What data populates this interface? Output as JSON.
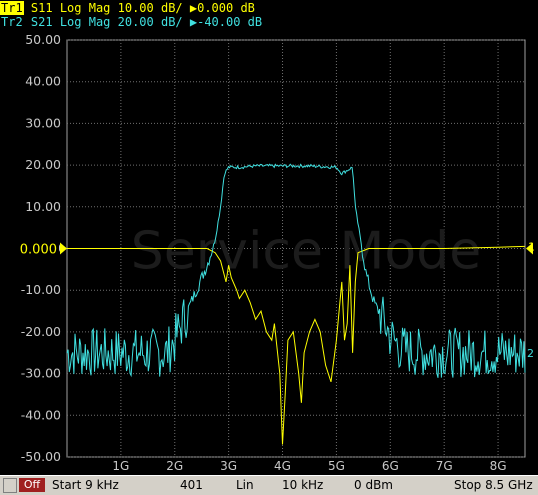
{
  "traces": [
    {
      "id_label": "Tr1",
      "text": "S11 Log Mag 10.00 dB/ ",
      "ref_marker": "▶",
      "ref_value": "0.000 dB",
      "color": "#ffff00"
    },
    {
      "id_label": "Tr2",
      "text": "S21 Log Mag 20.00 dB/ ",
      "ref_marker": "▶",
      "ref_value": "-40.00 dB",
      "color": "#40e0e0"
    }
  ],
  "watermark": "Service Mode",
  "ref_line_label": "0.000",
  "trace_end_labels": {
    "tr1": "1",
    "tr2": "2"
  },
  "chart_data": {
    "type": "line",
    "xlabel": "",
    "ylabel": "",
    "xlim": [
      9e-06,
      8.5
    ],
    "ylim": [
      -50,
      50
    ],
    "y_ticks": [
      "50.00",
      "40.00",
      "30.00",
      "20.00",
      "10.00",
      "0.000",
      "-10.00",
      "-20.00",
      "-30.00",
      "-40.00",
      "-50.00"
    ],
    "x_ticks": [
      "1G",
      "2G",
      "3G",
      "4G",
      "5G",
      "6G",
      "7G",
      "8G"
    ],
    "grid": true,
    "series": [
      {
        "name": "S11",
        "color": "#ffff00",
        "x": [
          0,
          2.6,
          2.75,
          2.85,
          2.95,
          3.0,
          3.05,
          3.15,
          3.2,
          3.3,
          3.4,
          3.5,
          3.6,
          3.7,
          3.8,
          3.85,
          3.95,
          4.0,
          4.05,
          4.1,
          4.2,
          4.3,
          4.35,
          4.4,
          4.5,
          4.6,
          4.7,
          4.8,
          4.9,
          5.0,
          5.1,
          5.15,
          5.2,
          5.25,
          5.3,
          5.35,
          5.4,
          5.5,
          5.6,
          6,
          7,
          8,
          8.5
        ],
        "y": [
          0,
          0,
          -1,
          -3,
          -8,
          -4,
          -7,
          -10,
          -12,
          -10,
          -13,
          -17,
          -15,
          -20,
          -22,
          -18,
          -30,
          -47,
          -35,
          -22,
          -20,
          -30,
          -37,
          -25,
          -20,
          -17,
          -20,
          -28,
          -32,
          -22,
          -8,
          -22,
          -18,
          -4,
          -25,
          -8,
          -1,
          -0.5,
          0,
          0,
          0,
          0.3,
          0.5
        ]
      },
      {
        "name": "S21",
        "color": "#40e0e0",
        "x": [
          0,
          0.5,
          1,
          1.5,
          1.85,
          2.0,
          2.2,
          2.4,
          2.6,
          2.75,
          2.85,
          2.92,
          3.0,
          3.2,
          3.5,
          4,
          4.5,
          5,
          5.1,
          5.3,
          5.35,
          5.45,
          5.55,
          5.7,
          5.9,
          6.0,
          6.2,
          6.5,
          7,
          7.5,
          8,
          8.5
        ],
        "y": [
          -25,
          -25,
          -25,
          -25,
          -25,
          -22,
          -16,
          -10,
          -4,
          2,
          10,
          18,
          19.5,
          19.5,
          19.8,
          19.8,
          19.8,
          19.5,
          18,
          19.5,
          10,
          2,
          -6,
          -13,
          -18,
          -21,
          -24,
          -25,
          -25,
          -25,
          -25,
          -25
        ],
        "noise": true
      }
    ]
  },
  "status_bar": {
    "off_label": "Off",
    "start": "Start 9 kHz",
    "points": "401",
    "sweep_type": "Lin",
    "ifbw": "10 kHz",
    "power": "0 dBm",
    "stop": "Stop 8.5 GHz"
  }
}
